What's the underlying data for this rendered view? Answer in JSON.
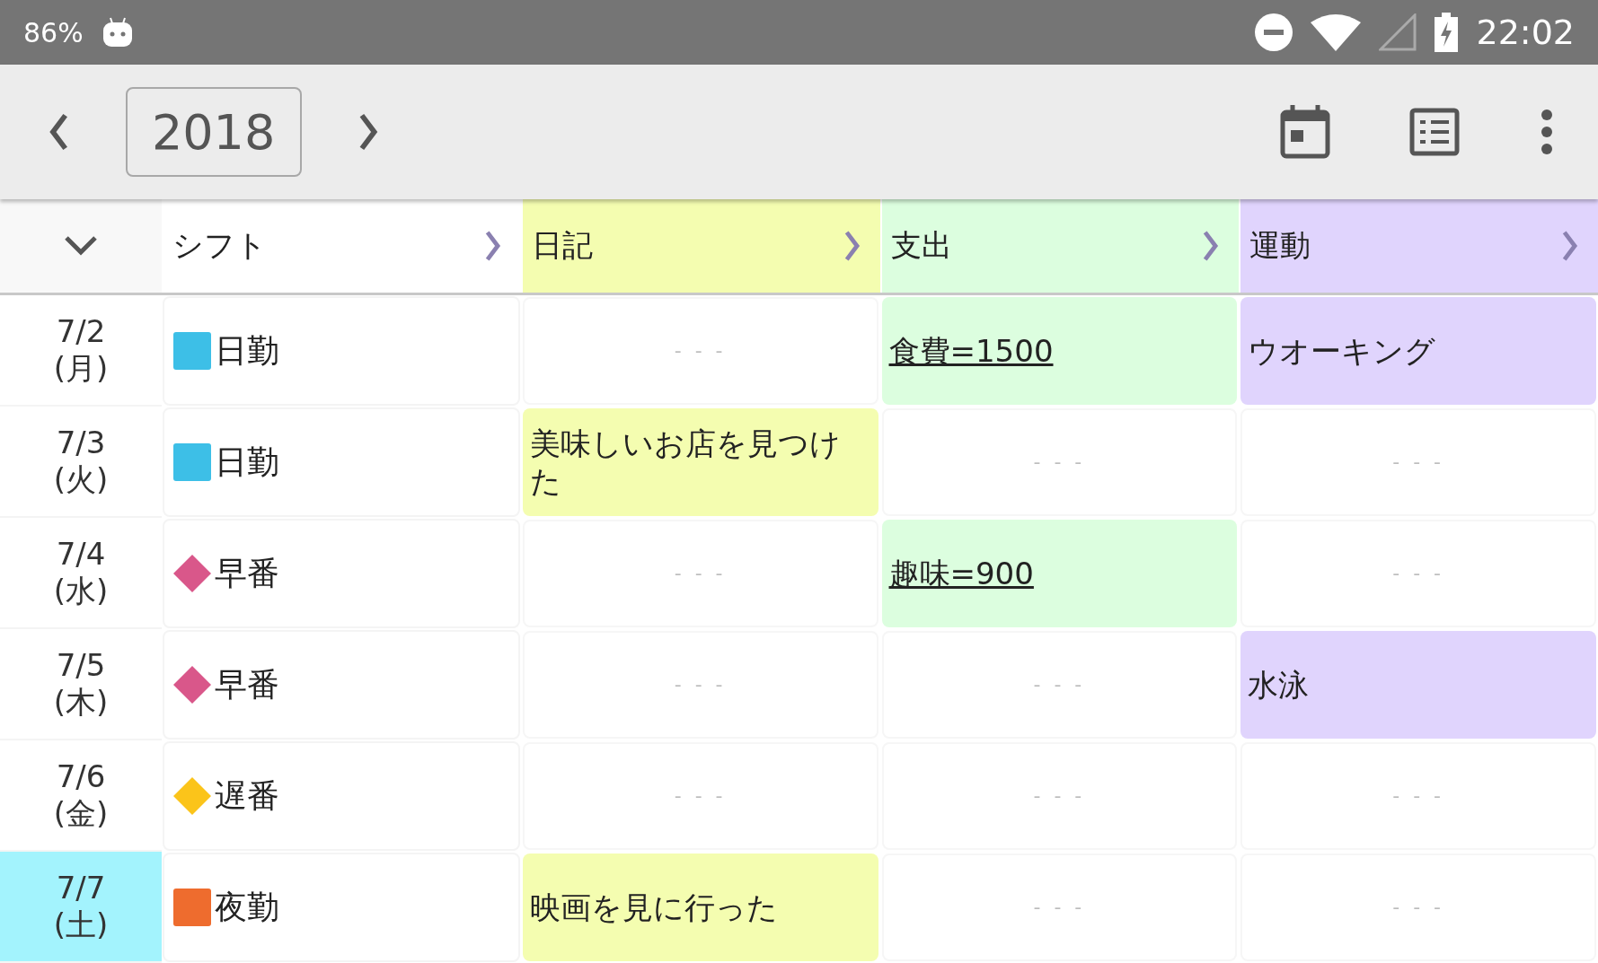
{
  "status_bar": {
    "battery_percent": "86%",
    "time": "22:02"
  },
  "toolbar": {
    "year": "2018"
  },
  "table": {
    "columns": [
      {
        "label": "シフト",
        "color": "#ffffff"
      },
      {
        "label": "日記",
        "color": "#f4fdb0"
      },
      {
        "label": "支出",
        "color": "#dcfedf"
      },
      {
        "label": "運動",
        "color": "#e0d4fd"
      }
    ],
    "rows": [
      {
        "date": "7/2",
        "weekday": "(月)",
        "selected": false,
        "shift": {
          "label": "日勤",
          "kind": "square",
          "color": "#3dbfe7"
        },
        "cells": [
          {
            "kind": "empty",
            "text": "- - -"
          },
          {
            "kind": "link",
            "text": "食費=1500"
          },
          {
            "kind": "text",
            "text": "ウオーキング"
          }
        ]
      },
      {
        "date": "7/3",
        "weekday": "(火)",
        "selected": false,
        "shift": {
          "label": "日勤",
          "kind": "square",
          "color": "#3dbfe7"
        },
        "cells": [
          {
            "kind": "text",
            "text": "美味しいお店を見つけた"
          },
          {
            "kind": "empty",
            "text": "- - -"
          },
          {
            "kind": "empty",
            "text": "- - -"
          }
        ]
      },
      {
        "date": "7/4",
        "weekday": "(水)",
        "selected": false,
        "shift": {
          "label": "早番",
          "kind": "diamond",
          "color": "#d9578a"
        },
        "cells": [
          {
            "kind": "empty",
            "text": "- - -"
          },
          {
            "kind": "link",
            "text": "趣味=900"
          },
          {
            "kind": "empty",
            "text": "- - -"
          }
        ]
      },
      {
        "date": "7/5",
        "weekday": "(木)",
        "selected": false,
        "shift": {
          "label": "早番",
          "kind": "diamond",
          "color": "#d9578a"
        },
        "cells": [
          {
            "kind": "empty",
            "text": "- - -"
          },
          {
            "kind": "empty",
            "text": "- - -"
          },
          {
            "kind": "text",
            "text": "水泳"
          }
        ]
      },
      {
        "date": "7/6",
        "weekday": "(金)",
        "selected": false,
        "shift": {
          "label": "遅番",
          "kind": "diamond",
          "color": "#fbc41a"
        },
        "cells": [
          {
            "kind": "empty",
            "text": "- - -"
          },
          {
            "kind": "empty",
            "text": "- - -"
          },
          {
            "kind": "empty",
            "text": "- - -"
          }
        ]
      },
      {
        "date": "7/7",
        "weekday": "(土)",
        "selected": true,
        "shift": {
          "label": "夜勤",
          "kind": "square",
          "color": "#ee6c2e"
        },
        "cells": [
          {
            "kind": "text",
            "text": "映画を見に行った"
          },
          {
            "kind": "empty",
            "text": "- - -"
          },
          {
            "kind": "empty",
            "text": "- - -"
          }
        ]
      }
    ]
  }
}
